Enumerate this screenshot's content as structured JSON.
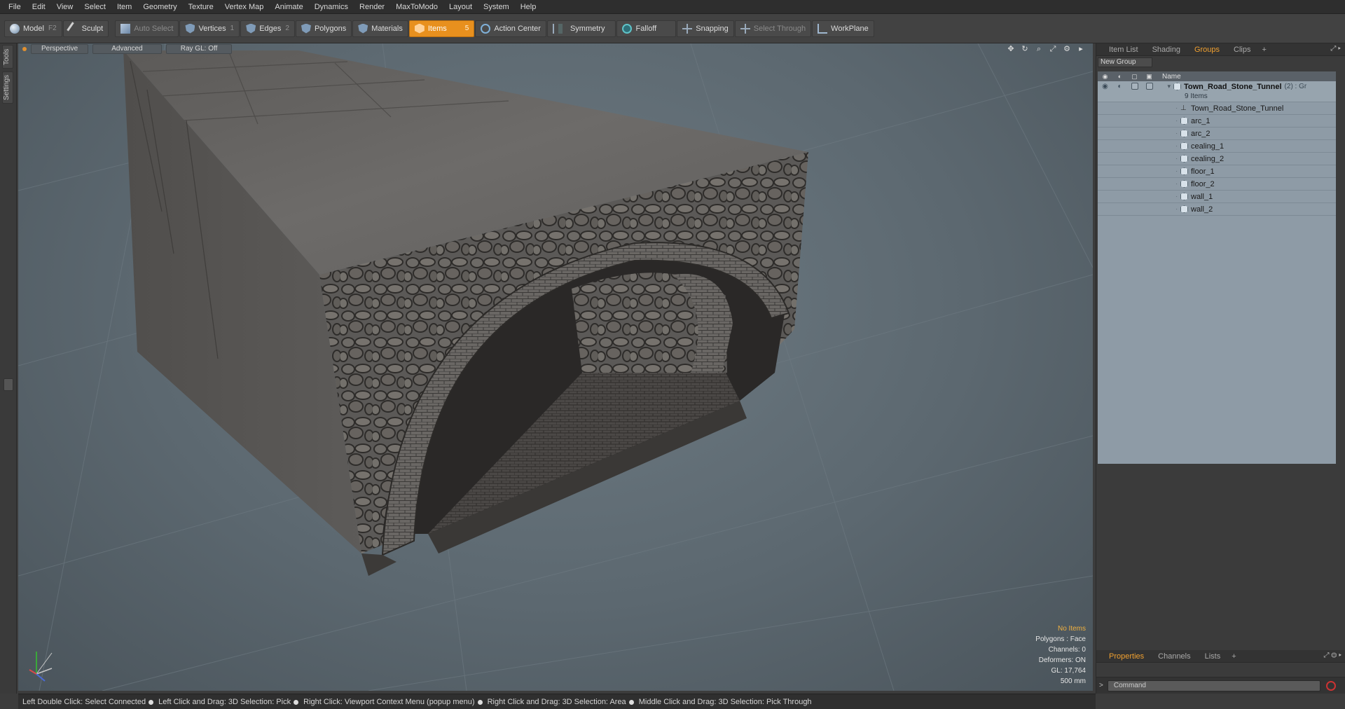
{
  "menu": [
    "File",
    "Edit",
    "View",
    "Select",
    "Item",
    "Geometry",
    "Texture",
    "Vertex Map",
    "Animate",
    "Dynamics",
    "Render",
    "MaxToModo",
    "Layout",
    "System",
    "Help"
  ],
  "toolbar": {
    "model": {
      "label": "Model",
      "key": "F2"
    },
    "sculpt": {
      "label": "Sculpt"
    },
    "auto_select": {
      "label": "Auto Select"
    },
    "vertices": {
      "label": "Vertices",
      "key": "1"
    },
    "edges": {
      "label": "Edges",
      "key": "2"
    },
    "polygons": {
      "label": "Polygons"
    },
    "materials": {
      "label": "Materials"
    },
    "items": {
      "label": "Items",
      "key": "5"
    },
    "action_center": {
      "label": "Action Center"
    },
    "symmetry": {
      "label": "Symmetry"
    },
    "falloff": {
      "label": "Falloff"
    },
    "snapping": {
      "label": "Snapping"
    },
    "select_through": {
      "label": "Select Through"
    },
    "workplane": {
      "label": "WorkPlane"
    }
  },
  "left_tabs": {
    "tools": "Tools",
    "settings": "Settings"
  },
  "viewport": {
    "perspective": "Perspective",
    "advanced": "Advanced",
    "raygl": "Ray GL: Off",
    "info": {
      "items": "No Items",
      "polygons": "Polygons : Face",
      "channels": "Channels: 0",
      "deformers": "Deformers: ON",
      "gl": "GL: 17,764",
      "scale": "500 mm"
    }
  },
  "panel_tabs": [
    "Item List",
    "Shading",
    "Groups",
    "Clips"
  ],
  "panel_active_tab": "Groups",
  "new_group": "New Group",
  "tree": {
    "name_header": "Name",
    "group": {
      "name": "Town_Road_Stone_Tunnel",
      "count": "(2) : Gr",
      "sub": "9 Items"
    },
    "items": [
      "Town_Road_Stone_Tunnel",
      "arc_1",
      "arc_2",
      "cealing_1",
      "cealing_2",
      "floor_1",
      "floor_2",
      "wall_1",
      "wall_2"
    ]
  },
  "bottom_tabs": [
    "Properties",
    "Channels",
    "Lists"
  ],
  "command_placeholder": "Command",
  "status": [
    "Left Double Click: Select Connected",
    "Left Click and Drag: 3D Selection: Pick",
    "Right Click: Viewport Context Menu (popup menu)",
    "Right Click and Drag: 3D Selection: Area",
    "Middle Click and Drag: 3D Selection: Pick Through"
  ],
  "colors": {
    "accent": "#e8901e",
    "viewport_bg": "#5c6870",
    "tree_bg": "#8e9ba6"
  }
}
